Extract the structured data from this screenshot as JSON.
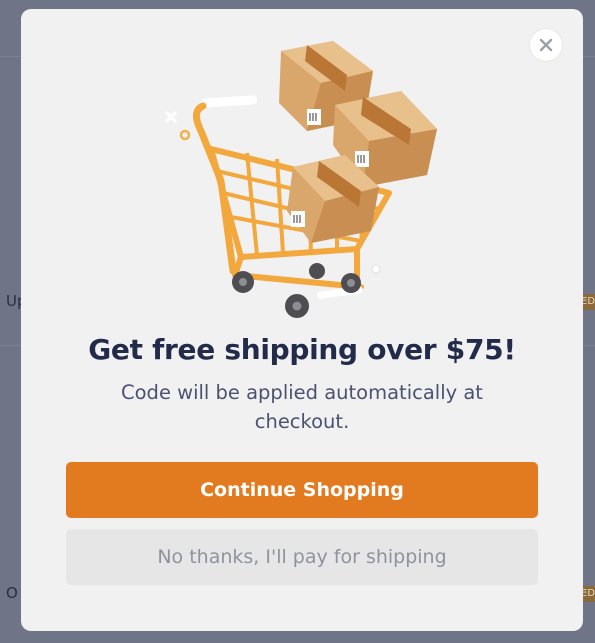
{
  "background": {
    "left_fragments": [
      "Up",
      "O"
    ],
    "right_badge": "ED"
  },
  "modal": {
    "close_label": "×",
    "headline": "Get free shipping over $75!",
    "subtext": "Code will be applied automatically at checkout.",
    "primary_button": "Continue Shopping",
    "secondary_button": "No thanks, I'll pay for shipping",
    "illustration": "shopping-cart-with-boxes"
  },
  "colors": {
    "accent": "#e27b1f",
    "headline": "#222b4a",
    "modal_bg": "#f1f1f1",
    "overlay": "#6f7486"
  }
}
